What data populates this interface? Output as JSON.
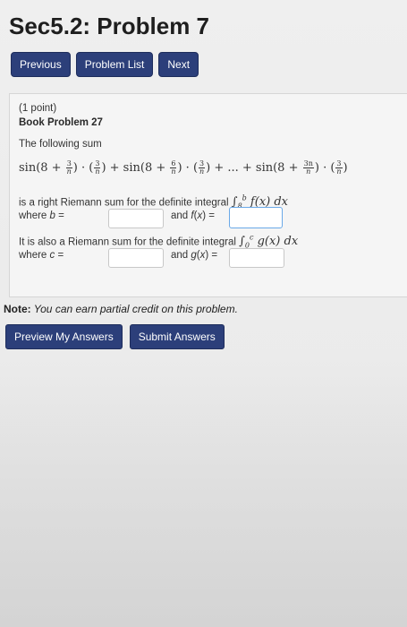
{
  "page": {
    "title": "Sec5.2: Problem 7"
  },
  "nav": {
    "previous": "Previous",
    "problem_list": "Problem List",
    "next": "Next"
  },
  "problem": {
    "points": "(1 point)",
    "book_problem": "Book Problem 27",
    "intro": "The following sum",
    "sum_expression": "sin(8 + 3/n) · (3/n) + sin(8 + 6/n) · (3/n) + ... + sin(8 + 3n/n) · (3/n)",
    "riemann_line": "is a right Riemann sum for the definite integral ∫₈ᵇ f(x) dx",
    "where_b": "where b =",
    "and_f": "and f(x) =",
    "also_line": "It is also a Riemann sum for the definite integral ∫₀ᶜ g(x) dx",
    "where_c": "where c =",
    "and_g": "and g(x) ="
  },
  "inputs": {
    "b_value": "",
    "f_value": "",
    "c_value": "",
    "g_value": ""
  },
  "note": {
    "label": "Note:",
    "text": " You can earn partial credit on this problem."
  },
  "actions": {
    "preview": "Preview My Answers",
    "submit": "Submit Answers"
  },
  "colors": {
    "button": "#2c3f7a",
    "active_field_border": "#6aa9e8",
    "panel": "#f5f5f5"
  }
}
